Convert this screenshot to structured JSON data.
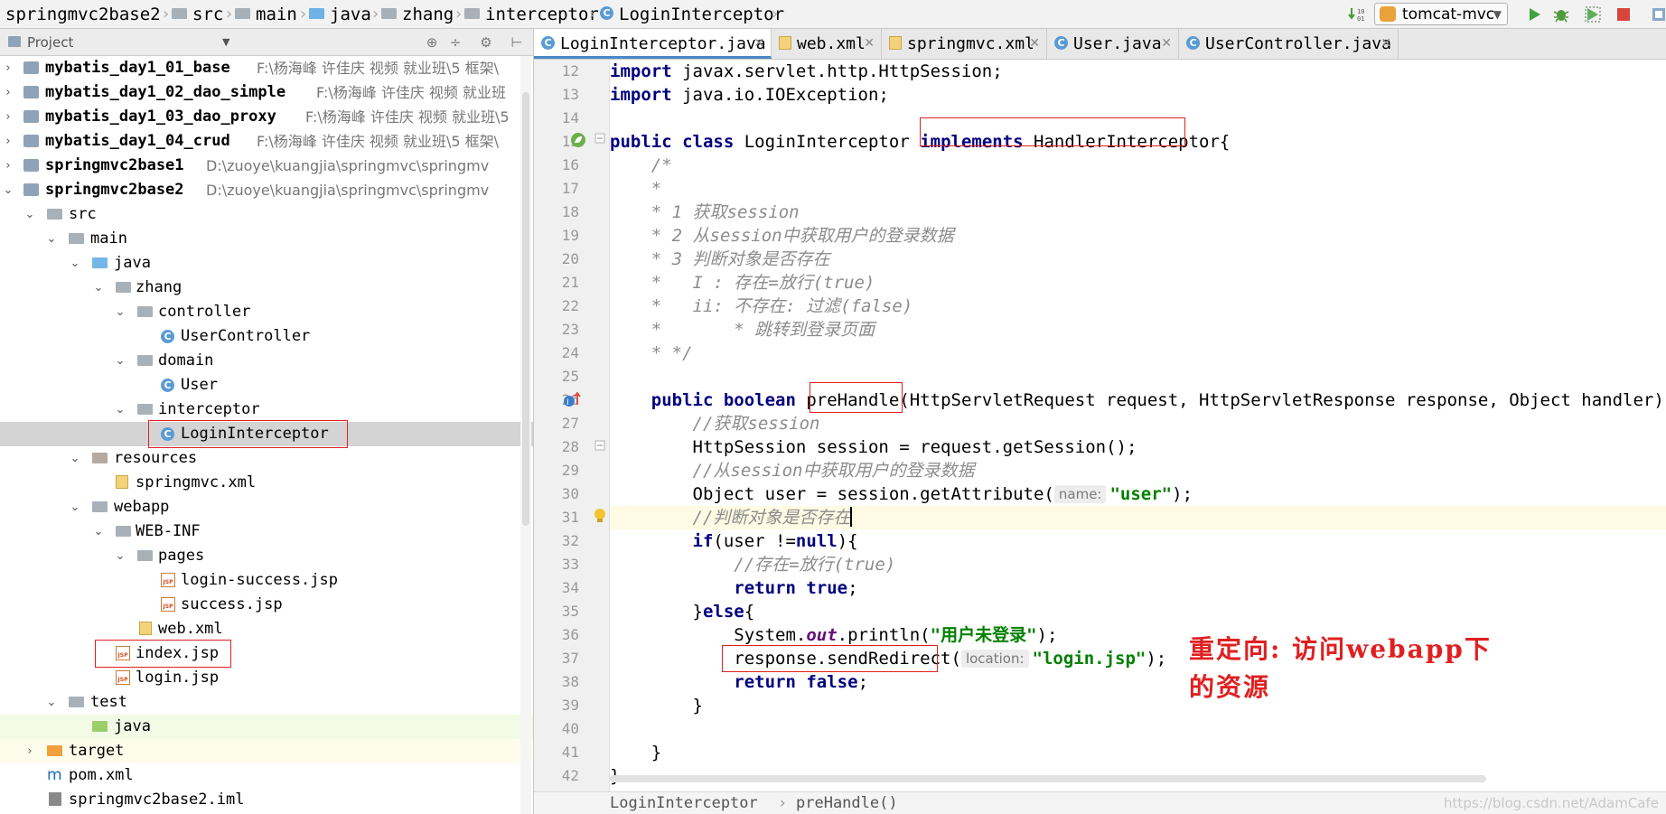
{
  "navbar": {
    "crumbs": [
      "springmvc2base2",
      "src",
      "main",
      "java",
      "zhang",
      "interceptor",
      "LoginInterceptor"
    ],
    "run_config": "tomcat-mvc"
  },
  "project_panel": {
    "title": "Project",
    "rows": [
      {
        "label": "mybatis_day1_01_base",
        "path": "F:\\杨海峰 许佳庆 视频 就业班\\5 框架\\"
      },
      {
        "label": "mybatis_day1_02_dao_simple",
        "path": "F:\\杨海峰 许佳庆 视频 就业班"
      },
      {
        "label": "mybatis_day1_03_dao_proxy",
        "path": "F:\\杨海峰 许佳庆 视频 就业班\\5"
      },
      {
        "label": "mybatis_day1_04_crud",
        "path": "F:\\杨海峰 许佳庆 视频 就业班\\5 框架\\"
      },
      {
        "label": "springmvc2base1",
        "path": "D:\\zuoye\\kuangjia\\springmvc\\springmv"
      },
      {
        "label": "springmvc2base2",
        "path": "D:\\zuoye\\kuangjia\\springmvc\\springmv"
      },
      {
        "label": "src"
      },
      {
        "label": "main"
      },
      {
        "label": "java"
      },
      {
        "label": "zhang"
      },
      {
        "label": "controller"
      },
      {
        "label": "UserController"
      },
      {
        "label": "domain"
      },
      {
        "label": "User"
      },
      {
        "label": "interceptor"
      },
      {
        "label": "LoginInterceptor"
      },
      {
        "label": "resources"
      },
      {
        "label": "springmvc.xml"
      },
      {
        "label": "webapp"
      },
      {
        "label": "WEB-INF"
      },
      {
        "label": "pages"
      },
      {
        "label": "login-success.jsp"
      },
      {
        "label": "success.jsp"
      },
      {
        "label": "web.xml"
      },
      {
        "label": "index.jsp"
      },
      {
        "label": "login.jsp"
      },
      {
        "label": "test"
      },
      {
        "label": "java"
      },
      {
        "label": "target"
      },
      {
        "label": "pom.xml"
      },
      {
        "label": "springmvc2base2.iml"
      }
    ]
  },
  "tabs": [
    {
      "label": "LoginInterceptor.java"
    },
    {
      "label": "web.xml"
    },
    {
      "label": "springmvc.xml"
    },
    {
      "label": "User.java"
    },
    {
      "label": "UserController.java"
    }
  ],
  "editor": {
    "line_numbers": [
      "12",
      "13",
      "14",
      "15",
      "16",
      "17",
      "18",
      "19",
      "20",
      "21",
      "22",
      "23",
      "24",
      "25",
      "26",
      "27",
      "28",
      "29",
      "30",
      "31",
      "32",
      "33",
      "34",
      "35",
      "36",
      "37",
      "38",
      "39",
      "40",
      "41",
      "42"
    ],
    "code": {
      "l12_kw": "import",
      "l12": " javax.servlet.http.HttpSession;",
      "l13_kw": "import",
      "l13": " java.io.IOException;",
      "l15_kw1": "public class",
      "l15_name": " LoginInterceptor ",
      "l15_kw2": "implements",
      "l15_rest": " HandlerInterceptor{",
      "l16": "    /*",
      "l17": "    *",
      "l18": "    * 1 获取session",
      "l19": "    * 2 从session中获取用户的登录数据",
      "l20": "    * 3 判断对象是否存在",
      "l21": "    *   I : 存在=放行(true)",
      "l22": "    *   ii: 不存在: 过滤(false)",
      "l23": "    *       * 跳转到登录页面",
      "l24": "    * */",
      "l26_indent": "    ",
      "l26_kw": "public boolean",
      "l26_method": " preHandle",
      "l26_rest": "(HttpServletRequest request, HttpServletResponse response, Object handler) th",
      "l27": "        //获取session",
      "l28": "        HttpSession session = request.getSession();",
      "l29": "        //从session中获取用户的登录数据",
      "l30_a": "        Object user = session.getAttribute(",
      "l30_hint": "name:",
      "l30_str": "\"user\"",
      "l30_b": ");",
      "l31": "        //判断对象是否存在",
      "l32_indent": "        ",
      "l32_kw1": "if",
      "l32_a": "(user !=",
      "l32_kw2": "null",
      "l32_b": "){",
      "l33": "            //存在=放行(true)",
      "l34_indent": "            ",
      "l34_kw": "return true",
      "l34_b": ";",
      "l35_a": "        }",
      "l35_kw": "else",
      "l35_b": "{",
      "l36_a": "            System.",
      "l36_fld": "out",
      "l36_b": ".println(",
      "l36_str": "\"用户未登录\"",
      "l36_c": ");",
      "l37_a": "            response.sendRedirect(",
      "l37_hint": "location:",
      "l37_str": "\"login.jsp\"",
      "l37_b": ");",
      "l38_indent": "            ",
      "l38_kw": "return false",
      "l38_b": ";",
      "l39": "        }",
      "l41": "    }",
      "l42": "}"
    },
    "annotation": [
      "重定向: 访问webapp下",
      "的资源"
    ]
  },
  "breadcrumb": {
    "items": [
      "LoginInterceptor",
      "preHandle()"
    ],
    "watermark": "https://blog.csdn.net/AdamCafe"
  },
  "colors": {
    "keyword": "#000080",
    "comment": "#8c8c8c",
    "string": "#008000",
    "annotation_red": "#e02020",
    "selection": "#d4d4d4"
  }
}
